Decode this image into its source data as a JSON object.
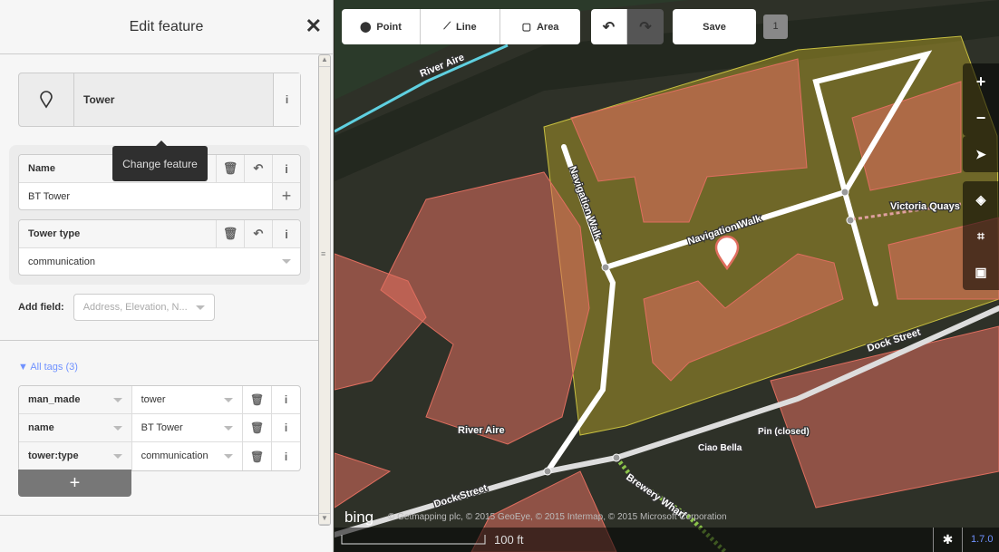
{
  "sidebar": {
    "title": "Edit feature",
    "close": "✕",
    "preset": {
      "name": "Tower",
      "info": "i"
    },
    "tooltip": "Change feature",
    "fields": [
      {
        "label": "Name",
        "value": "BT Tower",
        "add": "+"
      },
      {
        "label": "Tower type",
        "value": "communication"
      }
    ],
    "add_field": {
      "label": "Add field:",
      "placeholder": "Address, Elevation, N..."
    },
    "all_tags": "▼ All tags (3)",
    "tags": [
      {
        "key": "man_made",
        "value": "tower"
      },
      {
        "key": "name",
        "value": "BT Tower"
      },
      {
        "key": "tower:type",
        "value": "communication"
      }
    ],
    "add_tag": "+"
  },
  "toolbar": {
    "point": "Point",
    "line": "Line",
    "area": "Area",
    "save": "Save",
    "count": "1"
  },
  "map": {
    "labels": {
      "river1": "River Aire",
      "river2": "River Aire",
      "nav1": "Navigation Walk",
      "nav2": "Navigation Walk",
      "victoria": "Victoria Quays",
      "dock1": "Dock Street",
      "dock2": "Dock Street",
      "brewery": "Brewery Wharf",
      "pin": "Pin (closed)",
      "ciao": "Ciao Bella"
    },
    "attribution": "© Getmapping plc, © 2015 GeoEye, © 2015 Intermap, © 2015 Microsoft Corporation",
    "imagery": "bing",
    "scale": "100 ft",
    "version": "1.7.0"
  },
  "colors": {
    "building": "#e06e5f",
    "accent": "#7092ff"
  }
}
